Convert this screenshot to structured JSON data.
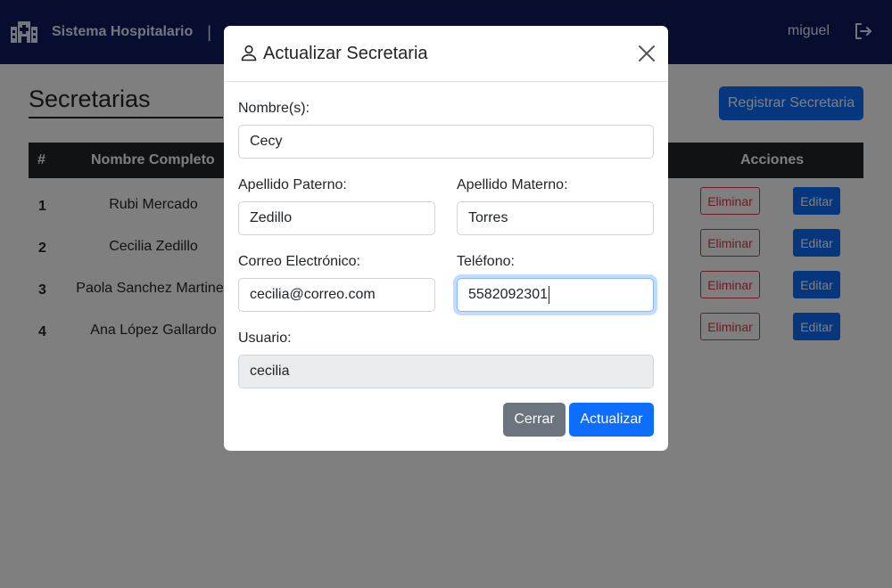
{
  "navbar": {
    "brand": "Sistema Hospitalario",
    "separator": "|",
    "user": "miguel",
    "logo_icon": "hospital-icon",
    "logout_icon": "logout-icon",
    "bg_color": "#0d1b5e"
  },
  "page": {
    "title": "Secretarias",
    "register_button": "Registrar Secretaria"
  },
  "table": {
    "headers": {
      "num": "#",
      "name": "Nombre Completo",
      "actions": "Acciones"
    },
    "rows": [
      {
        "num": "1",
        "name": "Rubi Mercado",
        "delete": "Eliminar",
        "edit": "Editar"
      },
      {
        "num": "2",
        "name": "Cecilia Zedillo",
        "delete": "Eliminar",
        "edit": "Editar"
      },
      {
        "num": "3",
        "name": "Paola Sanchez Martinez",
        "delete": "Eliminar",
        "edit": "Editar"
      },
      {
        "num": "4",
        "name": "Ana López Gallardo",
        "delete": "Eliminar",
        "edit": "Editar"
      }
    ]
  },
  "modal": {
    "title": "Actualizar Secretaria",
    "title_icon": "user-icon",
    "close_icon": "close-icon",
    "fields": {
      "nombre": {
        "label": "Nombre(s):",
        "value": "Cecy"
      },
      "apellido_paterno": {
        "label": "Apellido Paterno:",
        "value": "Zedillo"
      },
      "apellido_materno": {
        "label": "Apellido Materno:",
        "value": "Torres"
      },
      "correo": {
        "label": "Correo Electrónico:",
        "value": "cecilia@correo.com"
      },
      "telefono": {
        "label": "Teléfono:",
        "value": "5582092301"
      },
      "usuario": {
        "label": "Usuario:",
        "value": "cecilia"
      }
    },
    "buttons": {
      "close": "Cerrar",
      "update": "Actualizar"
    }
  },
  "colors": {
    "primary": "#0d6efd",
    "danger": "#dc3545",
    "secondary": "#6c757d"
  }
}
